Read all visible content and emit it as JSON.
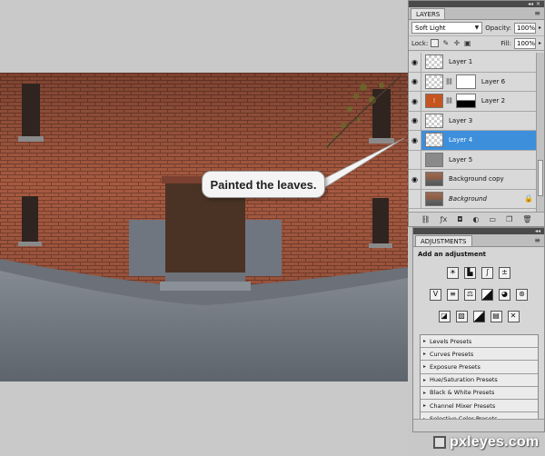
{
  "callout": {
    "text": "Painted the leaves."
  },
  "watermark": {
    "text": "pxleyes.com"
  },
  "layers_panel": {
    "tab": "LAYERS",
    "blend_mode": "Soft Light",
    "opacity_label": "Opacity:",
    "opacity_value": "100%",
    "lock_label": "Lock:",
    "fill_label": "Fill:",
    "fill_value": "100%",
    "layers": [
      {
        "name": "Layer 1",
        "visible": true
      },
      {
        "name": "Layer 6",
        "visible": true
      },
      {
        "name": "Layer 2",
        "visible": true
      },
      {
        "name": "Layer 3",
        "visible": true
      },
      {
        "name": "Layer 4",
        "visible": true,
        "selected": true
      },
      {
        "name": "Layer 5",
        "visible": false
      },
      {
        "name": "Background copy",
        "visible": true
      },
      {
        "name": "Background",
        "visible": false,
        "locked": true
      }
    ]
  },
  "adjustments_panel": {
    "tab": "ADJUSTMENTS",
    "heading": "Add an adjustment",
    "presets": [
      "Levels Presets",
      "Curves Presets",
      "Exposure Presets",
      "Hue/Saturation Presets",
      "Black & White Presets",
      "Channel Mixer Presets",
      "Selective Color Presets"
    ]
  },
  "colors": {
    "selection": "#3d8fdc",
    "brick": "#a3553c",
    "panel": "#d6d6d6"
  }
}
